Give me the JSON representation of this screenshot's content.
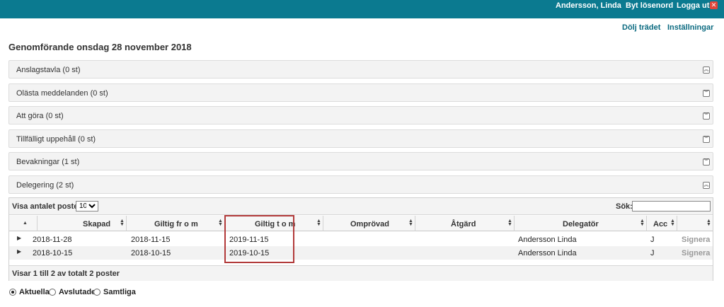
{
  "topbar": {
    "user_name": "Andersson, Linda",
    "change_password": "Byt lösenord",
    "logout": "Logga ut",
    "logout_icon": "close-icon",
    "background_color": "#0b7a90"
  },
  "toplinks": {
    "hide_tree": "Dölj trädet",
    "settings": "Inställningar"
  },
  "page_title": "Genomförande onsdag 28 november 2018",
  "panels": [
    {
      "title": "Anslagstavla (0 st)",
      "state": "expanded"
    },
    {
      "title": "Olästa meddelanden (0 st)",
      "state": "collapsed"
    },
    {
      "title": "Att göra (0 st)",
      "state": "collapsed"
    },
    {
      "title": "Tillfälligt uppehåll (0 st)",
      "state": "collapsed"
    },
    {
      "title": "Bevakningar (1 st)",
      "state": "collapsed"
    },
    {
      "title": "Delegering (2 st)",
      "state": "expanded"
    }
  ],
  "grid": {
    "show_label": "Visa antalet poster",
    "page_size": "10",
    "search_label": "Sök:",
    "search_value": "",
    "columns": [
      "Skapad",
      "Giltig fr o m",
      "Giltig t o m",
      "Omprövad",
      "Åtgärd",
      "Delegatör",
      "Acc",
      ""
    ],
    "rows": [
      {
        "skapad": "2018-11-28",
        "giltig_from": "2018-11-15",
        "giltig_tom": "2019-11-15",
        "omprovad": "",
        "atgard": "",
        "delegator": "Andersson Linda",
        "acc": "J",
        "action": "Signera"
      },
      {
        "skapad": "2018-10-15",
        "giltig_from": "2018-10-15",
        "giltig_tom": "2019-10-15",
        "omprovad": "",
        "atgard": "",
        "delegator": "Andersson Linda",
        "acc": "J",
        "action": "Signera"
      }
    ],
    "footer": "Visar 1 till 2 av totalt 2 poster"
  },
  "filters": {
    "options": [
      "Aktuella",
      "Avslutade",
      "Samtliga"
    ],
    "selected": "Aktuella"
  },
  "highlight_color": "#b23a3a"
}
